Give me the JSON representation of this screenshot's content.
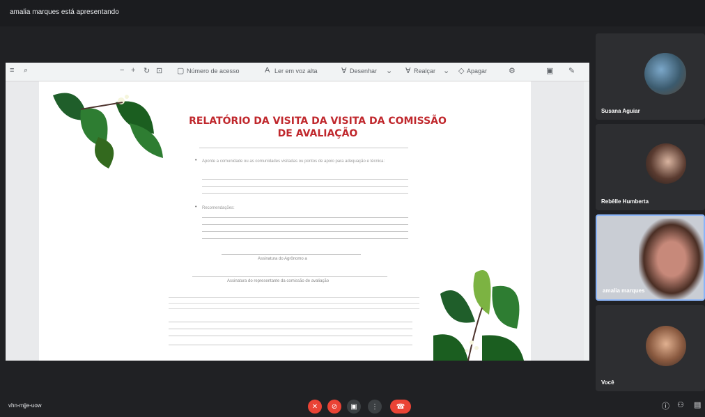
{
  "top_bar": {
    "presenting_text": "amalia marques está apresentando"
  },
  "doc_toolbar": {
    "tool_1": "Número de acesso",
    "tool_2": "Ler em voz alta",
    "tool_3": "Desenhar",
    "tool_4": "Realçar",
    "tool_5": "Apagar"
  },
  "document": {
    "title_line1": "RELATÓRIO DA VISITA DA VISITA DA COMISSÃO",
    "title_line2": "DE AVALIAÇÃO",
    "section_1": "Aponte a comunidade ou as comunidades visitadas ou pontos de apoio para adequação e técnica:",
    "section_2": "Recomendações:",
    "sign_line_1": "Assinatura do Agrônomo a",
    "sign_line_2": "Assinatura do representante da comissão de avaliação"
  },
  "participants": [
    {
      "name": "Susana Aguiar"
    },
    {
      "name": "Rebêlle Humberta"
    },
    {
      "name": "amalia marques"
    },
    {
      "name": "Você"
    }
  ],
  "bottom_bar": {
    "meeting_code": "vhn-mjje-uow"
  },
  "colors": {
    "title_red": "#c0282d",
    "end_call_red": "#ea4335",
    "active_speaker_blue": "#8ab4f8"
  }
}
